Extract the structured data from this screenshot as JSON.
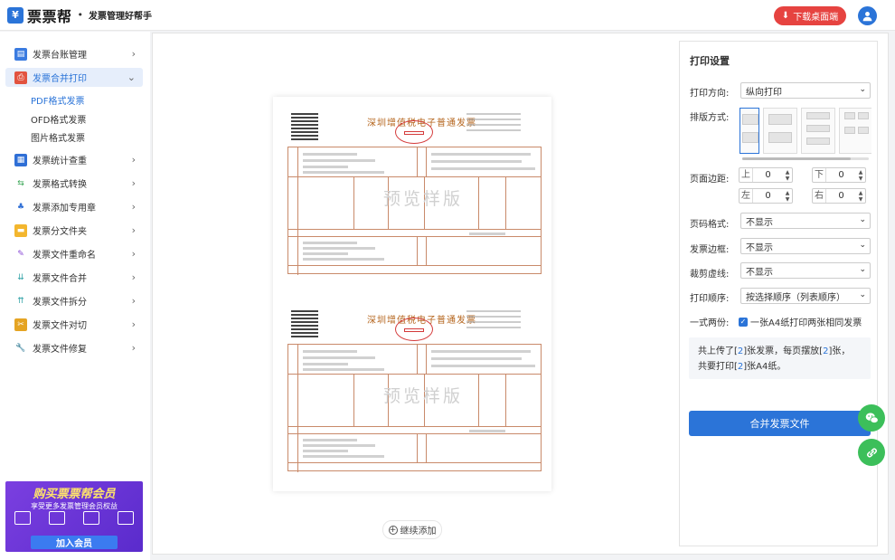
{
  "header": {
    "logo_mark": "¥",
    "brand": "票票帮",
    "separator": "•",
    "slogan": "发票管理好帮手",
    "download_label": "下载桌面端"
  },
  "sidebar": {
    "items": [
      {
        "label": "发票台账管理"
      },
      {
        "label": "发票合并打印"
      },
      {
        "label": "发票统计查重"
      },
      {
        "label": "发票格式转换"
      },
      {
        "label": "发票添加专用章"
      },
      {
        "label": "发票分文件夹"
      },
      {
        "label": "发票文件重命名"
      },
      {
        "label": "发票文件合并"
      },
      {
        "label": "发票文件拆分"
      },
      {
        "label": "发票文件对切"
      },
      {
        "label": "发票文件修复"
      }
    ],
    "sub_items": [
      {
        "label": "PDF格式发票"
      },
      {
        "label": "OFD格式发票"
      },
      {
        "label": "图片格式发票"
      }
    ],
    "vip": {
      "title": "购买票票帮会员",
      "subtitle": "享受更多发票管理会员权益",
      "button": "加入会员"
    }
  },
  "preview": {
    "invoice_title": "深圳增值税电子普通发票",
    "watermark": "预览样版",
    "continue_add": "继续添加"
  },
  "settings": {
    "title": "打印设置",
    "direction_label": "打印方向:",
    "direction_value": "纵向打印",
    "layout_label": "排版方式:",
    "margin_label": "页面边距:",
    "margins": {
      "top_label": "上",
      "top_value": "0",
      "bottom_label": "下",
      "bottom_value": "0",
      "left_label": "左",
      "left_value": "0",
      "right_label": "右",
      "right_value": "0"
    },
    "page_number_label": "页码格式:",
    "page_number_value": "不显示",
    "border_label": "发票边框:",
    "border_value": "不显示",
    "cut_label": "裁剪虚线:",
    "cut_value": "不显示",
    "order_label": "打印顺序:",
    "order_value": "按选择顺序（列表顺序）",
    "duplicate_label": "一式两份:",
    "duplicate_checkbox": "一张A4纸打印两张相同发票",
    "info_part1": "共上传了[",
    "uploaded_count": "2",
    "info_part2": "]张发票，每页摆放[",
    "per_page_count": "2",
    "info_part3": "]张，",
    "info_part4": "共要打印[",
    "print_count": "2",
    "info_part5": "]张A4纸。",
    "merge_button": "合并发票文件"
  },
  "colors": {
    "accent": "#2b74d8",
    "download_red": "#e64340",
    "float_green": "#3cbf5a",
    "vip_purple": "#6a35d8"
  }
}
